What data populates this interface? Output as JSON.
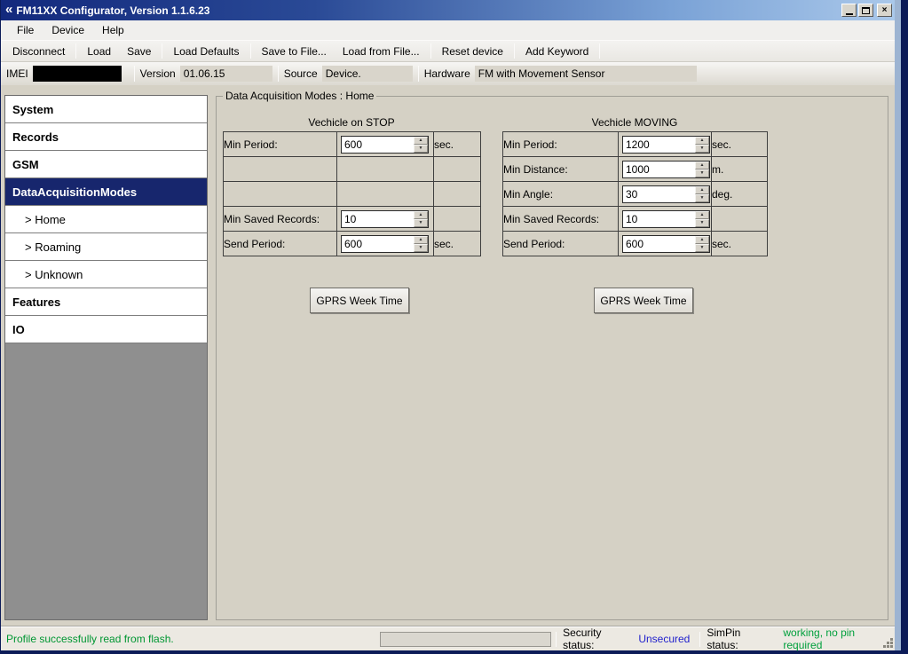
{
  "window": {
    "title": "FM11XX Configurator, Version 1.1.6.23",
    "logo_glyph": "«"
  },
  "menu": {
    "file": "File",
    "device": "Device",
    "help": "Help"
  },
  "toolbar": {
    "disconnect": "Disconnect",
    "load": "Load",
    "save": "Save",
    "load_defaults": "Load Defaults",
    "save_to_file": "Save to File...",
    "load_from_file": "Load from File...",
    "reset_device": "Reset device",
    "add_keyword": "Add Keyword"
  },
  "infobar": {
    "imei_label": "IMEI",
    "version_label": "Version",
    "version_value": "01.06.15",
    "source_label": "Source",
    "source_value": "Device.",
    "hardware_label": "Hardware",
    "hardware_value": "FM with Movement Sensor"
  },
  "sidebar": {
    "items": [
      {
        "label": "System",
        "selected": false,
        "sub": false
      },
      {
        "label": "Records",
        "selected": false,
        "sub": false
      },
      {
        "label": "GSM",
        "selected": false,
        "sub": false
      },
      {
        "label": "DataAcquisitionModes",
        "selected": true,
        "sub": false
      },
      {
        "label": "> Home",
        "selected": false,
        "sub": true
      },
      {
        "label": "> Roaming",
        "selected": false,
        "sub": true
      },
      {
        "label": "> Unknown",
        "selected": false,
        "sub": true
      },
      {
        "label": "Features",
        "selected": false,
        "sub": false
      },
      {
        "label": "IO",
        "selected": false,
        "sub": false
      }
    ]
  },
  "main": {
    "group_title": "Data Acquisition Modes : Home",
    "stop_panel": {
      "title": "Vechicle on STOP",
      "rows": [
        {
          "label": "Min Period:",
          "value": "600",
          "unit": "sec."
        },
        {
          "label": "",
          "value": null,
          "unit": ""
        },
        {
          "label": "",
          "value": null,
          "unit": ""
        },
        {
          "label": "Min Saved Records:",
          "value": "10",
          "unit": ""
        },
        {
          "label": "Send Period:",
          "value": "600",
          "unit": "sec."
        }
      ],
      "button_label": "GPRS Week Time"
    },
    "moving_panel": {
      "title": "Vechicle MOVING",
      "rows": [
        {
          "label": "Min Period:",
          "value": "1200",
          "unit": "sec."
        },
        {
          "label": "Min Distance:",
          "value": "1000",
          "unit": "m."
        },
        {
          "label": "Min Angle:",
          "value": "30",
          "unit": "deg."
        },
        {
          "label": "Min Saved Records:",
          "value": "10",
          "unit": ""
        },
        {
          "label": "Send Period:",
          "value": "600",
          "unit": "sec."
        }
      ],
      "button_label": "GPRS Week Time"
    }
  },
  "statusbar": {
    "message": "Profile successfully read from flash.",
    "security_label": "Security status:",
    "security_value": "Unsecured",
    "simpin_label": "SimPin status:",
    "simpin_value": "working, no pin required"
  },
  "colors": {
    "titlebar_gradient_start": "#13297d",
    "titlebar_gradient_end": "#aac8ea",
    "nav_selected_bg": "#17266d",
    "status_message_green": "#009632",
    "security_blue": "#2222cc",
    "simpin_green": "#00a03c",
    "content_bg": "#d5d1c5"
  }
}
